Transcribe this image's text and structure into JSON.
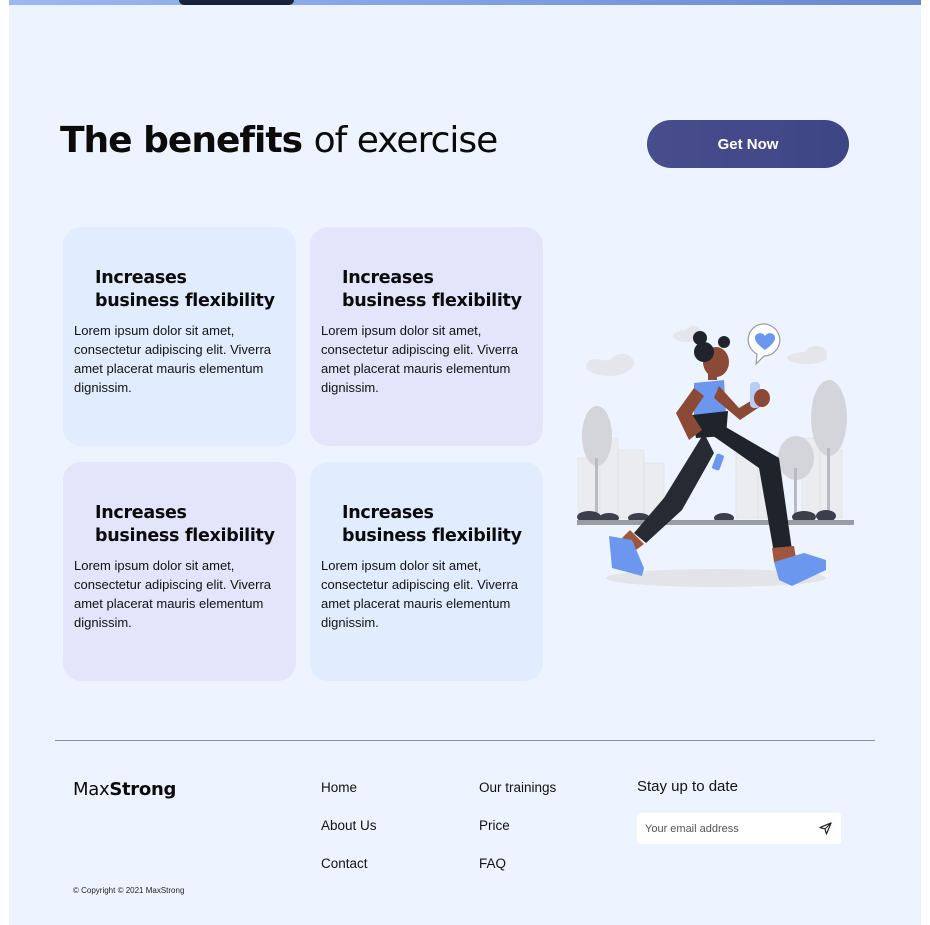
{
  "hero": {
    "title_bold": "The benefits",
    "title_light": "of exercise",
    "cta_label": "Get Now"
  },
  "cards": [
    {
      "title": "Increases business flexibility",
      "text": "Lorem ipsum dolor sit amet, consectetur adipiscing elit. Viverra amet placerat mauris elementum dignissim."
    },
    {
      "title": "Increases business flexibility",
      "text": "Lorem ipsum dolor sit amet, consectetur adipiscing elit. Viverra amet placerat mauris elementum dignissim."
    },
    {
      "title": "Increases business flexibility",
      "text": "Lorem ipsum dolor sit amet, consectetur adipiscing elit. Viverra amet placerat mauris elementum dignissim."
    },
    {
      "title": "Increases business flexibility",
      "text": "Lorem ipsum dolor sit amet, consectetur adipiscing elit. Viverra amet placerat mauris elementum dignissim."
    }
  ],
  "footer": {
    "logo_light": "Max",
    "logo_bold": "Strong",
    "nav": {
      "home": "Home",
      "about": "About Us",
      "contact": "Contact",
      "trainings": "Our trainings",
      "price": "Price",
      "faq": "FAQ"
    },
    "newsletter_title": "Stay up to date",
    "email_placeholder": "Your email address",
    "copyright": "© Copyright © 2021 MaxStrong"
  },
  "colors": {
    "page_bg": "#eef4ff",
    "cta_bg": "#484d8c",
    "card_blue": "#e1edff",
    "card_lavender": "#e3e6fb",
    "accent_blue": "#6c97ee"
  },
  "icons": {
    "send": "send-icon",
    "heart_bubble": "heart-icon"
  }
}
